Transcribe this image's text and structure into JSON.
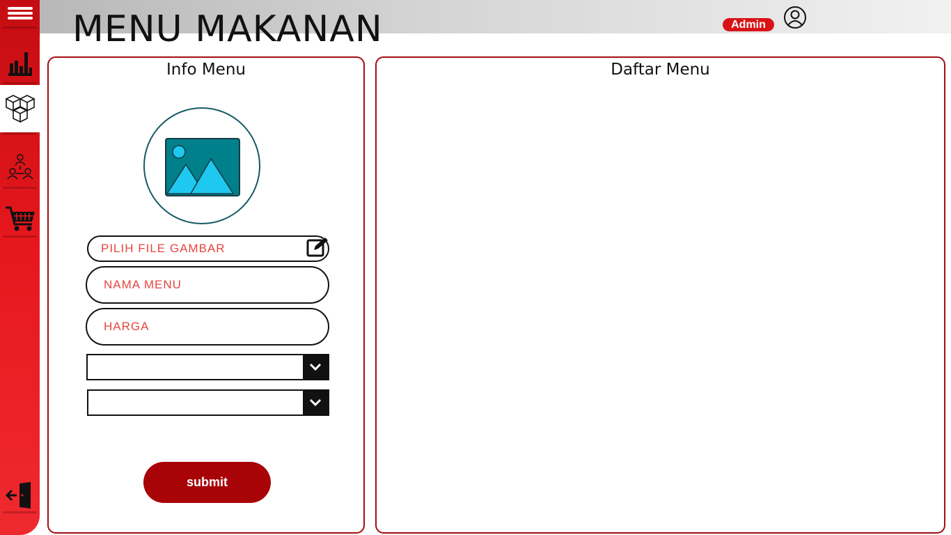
{
  "header": {
    "title": "MENU MAKANAN",
    "user_badge": "Admin",
    "avatar_icon": "user-circle-icon"
  },
  "sidebar": {
    "items": [
      {
        "icon": "hamburger-menu-icon",
        "active": false
      },
      {
        "icon": "bar-chart-icon",
        "active": false
      },
      {
        "icon": "boxes-icon",
        "active": true
      },
      {
        "icon": "user-network-icon",
        "active": false
      },
      {
        "icon": "shopping-cart-icon",
        "active": false
      },
      {
        "icon": "logout-door-icon",
        "active": false
      }
    ]
  },
  "info_panel": {
    "title": "Info Menu",
    "image_placeholder_icon": "image-icon",
    "file_input_label": "PILIH FILE GAMBAR",
    "file_edit_icon": "edit-icon",
    "name_placeholder": "NAMA MENU",
    "price_placeholder": "HARGA",
    "select_1_value": "",
    "select_2_value": "",
    "submit_label": "submit"
  },
  "list_panel": {
    "title": "Daftar Menu"
  },
  "colors": {
    "sidebar_red": "#e5171d",
    "panel_border": "#a30d12",
    "submit_bg": "#a80408",
    "placeholder_text": "#e5453f",
    "badge_bg": "#d81317",
    "image_icon_bg": "#00808a",
    "image_icon_fg": "#1ec8f0"
  }
}
